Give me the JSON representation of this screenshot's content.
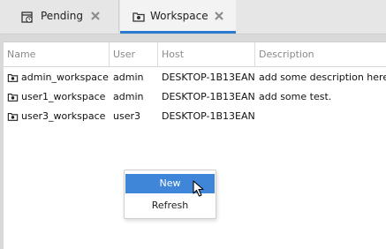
{
  "tabs": [
    {
      "label": "Pending",
      "icon": "calendar-clock-icon",
      "active": false
    },
    {
      "label": "Workspace",
      "icon": "folder-workspace-icon",
      "active": true
    }
  ],
  "table": {
    "columns": [
      "Name",
      "User",
      "Host",
      "Description"
    ],
    "rows": [
      {
        "name": "admin_workspace",
        "user": "admin",
        "host": "DESKTOP-1B13EAN",
        "description": "add some description here."
      },
      {
        "name": "user1_workspace",
        "user": "admin",
        "host": "DESKTOP-1B13EAN",
        "description": "add some test."
      },
      {
        "name": "user3_workspace",
        "user": "user3",
        "host": "DESKTOP-1B13EAN",
        "description": ""
      }
    ]
  },
  "context_menu": {
    "items": [
      {
        "label": "New",
        "highlighted": true
      },
      {
        "label": "Refresh",
        "highlighted": false
      }
    ]
  },
  "colors": {
    "accent": "#2b7bd1",
    "menu_highlight": "#3f86d9",
    "header_text": "#8a8a8a"
  }
}
